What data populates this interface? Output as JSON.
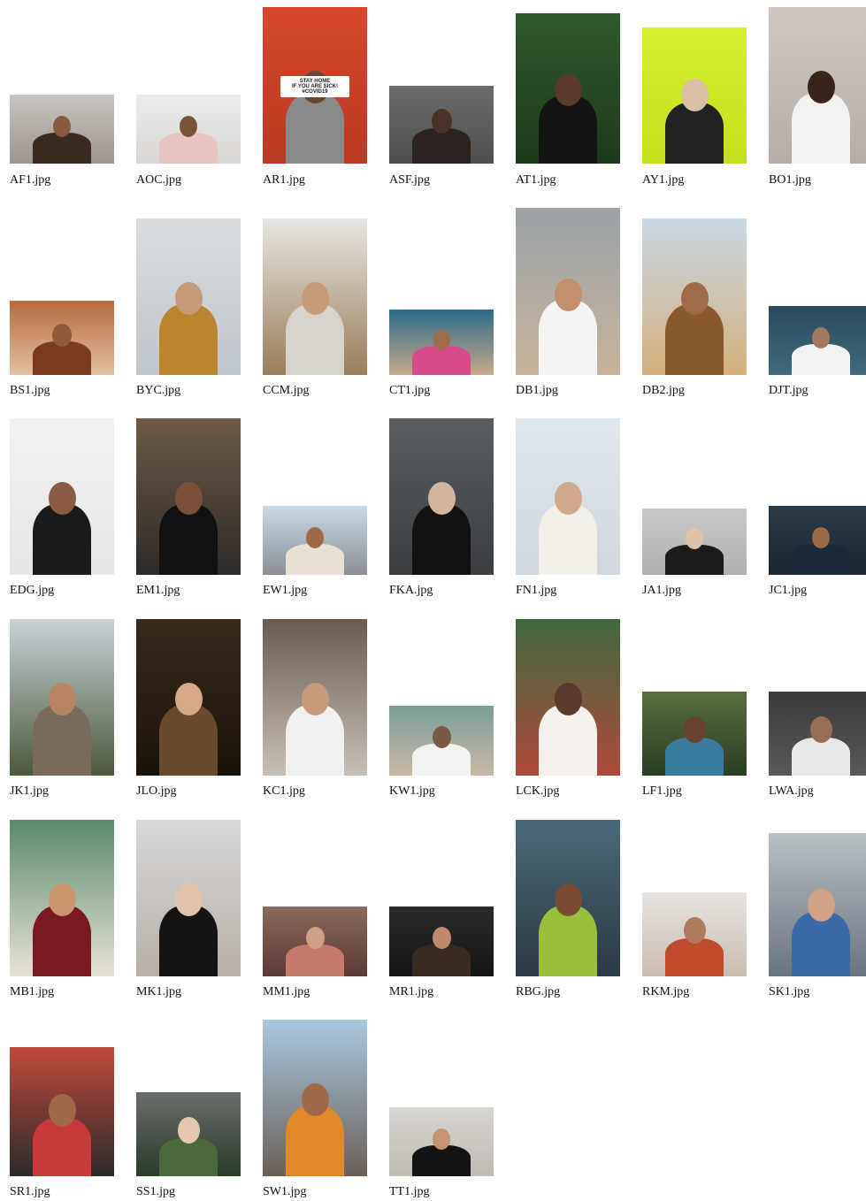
{
  "files": [
    {
      "name": "AF1.jpg",
      "depicts": "portrait"
    },
    {
      "name": "AOC.jpg",
      "depicts": "portrait"
    },
    {
      "name": "AR1.jpg",
      "depicts": "portrait",
      "sign_text": "STAY HOME\nIF YOU ARE SICK!\n#COVID19"
    },
    {
      "name": "ASF.jpg",
      "depicts": "portrait"
    },
    {
      "name": "AT1.jpg",
      "depicts": "portrait"
    },
    {
      "name": "AY1.jpg",
      "depicts": "portrait"
    },
    {
      "name": "BO1.jpg",
      "depicts": "portrait"
    },
    {
      "name": "BS1.jpg",
      "depicts": "portrait"
    },
    {
      "name": "BYC.jpg",
      "depicts": "portrait"
    },
    {
      "name": "CCM.jpg",
      "depicts": "portrait"
    },
    {
      "name": "CT1.jpg",
      "depicts": "portrait"
    },
    {
      "name": "DB1.jpg",
      "depicts": "portrait"
    },
    {
      "name": "DB2.jpg",
      "depicts": "portrait"
    },
    {
      "name": "DJT.jpg",
      "depicts": "portrait"
    },
    {
      "name": "EDG.jpg",
      "depicts": "portrait"
    },
    {
      "name": "EM1.jpg",
      "depicts": "portrait"
    },
    {
      "name": "EW1.jpg",
      "depicts": "portrait"
    },
    {
      "name": "FKA.jpg",
      "depicts": "portrait"
    },
    {
      "name": "FN1.jpg",
      "depicts": "portrait"
    },
    {
      "name": "JA1.jpg",
      "depicts": "portrait"
    },
    {
      "name": "JC1.jpg",
      "depicts": "portrait"
    },
    {
      "name": "JK1.jpg",
      "depicts": "portrait"
    },
    {
      "name": "JLO.jpg",
      "depicts": "portrait"
    },
    {
      "name": "KC1.jpg",
      "depicts": "portrait"
    },
    {
      "name": "KW1.jpg",
      "depicts": "portrait"
    },
    {
      "name": "LCK.jpg",
      "depicts": "portrait"
    },
    {
      "name": "LF1.jpg",
      "depicts": "portrait"
    },
    {
      "name": "LWA.jpg",
      "depicts": "portrait"
    },
    {
      "name": "MB1.jpg",
      "depicts": "portrait"
    },
    {
      "name": "MK1.jpg",
      "depicts": "portrait"
    },
    {
      "name": "MM1.jpg",
      "depicts": "portrait"
    },
    {
      "name": "MR1.jpg",
      "depicts": "portrait"
    },
    {
      "name": "RBG.jpg",
      "depicts": "portrait"
    },
    {
      "name": "RKM.jpg",
      "depicts": "portrait"
    },
    {
      "name": "SK1.jpg",
      "depicts": "portrait"
    },
    {
      "name": "SR1.jpg",
      "depicts": "portrait"
    },
    {
      "name": "SS1.jpg",
      "depicts": "portrait"
    },
    {
      "name": "SW1.jpg",
      "depicts": "portrait"
    },
    {
      "name": "TT1.jpg",
      "depicts": "portrait"
    }
  ]
}
